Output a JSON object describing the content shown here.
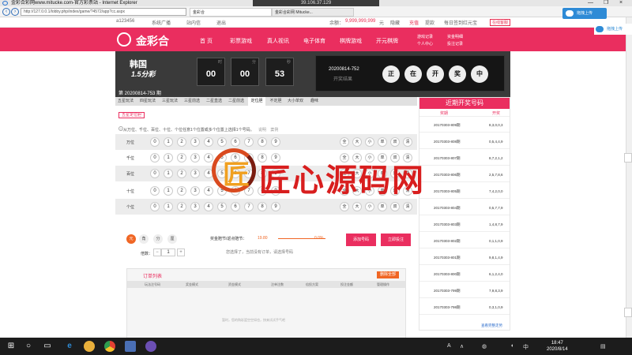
{
  "remote": {
    "ip": "39.106.37.129",
    "min": "—",
    "restore": "❐",
    "close": "×"
  },
  "ie": {
    "title": "金彩合彩网www.mitucke.com-官方彩票站 - Internet Explorer",
    "address": "http://127.0.0.1/lobby.php/index/game/?4572/app?cc.aspx",
    "tabs": [
      "金彩合",
      "金彩合彩网 Mitucke..."
    ],
    "nav_back": "‹",
    "nav_forward": "›"
  },
  "site_top": {
    "user": "a123456",
    "notice": "系统广播",
    "messages": "站内信",
    "logout_link": "退出",
    "balance_label": "余额：",
    "balance": "9,999,999,999",
    "balance_unit": "元",
    "hide": "隐藏",
    "recharge": "充值",
    "withdraw": "提款",
    "signin": "每日签到红元宝",
    "logout_btn": "在线客服"
  },
  "header": {
    "brand": "金彩合",
    "menu": [
      "首 页",
      "彩票游戏",
      "真人视讯",
      "电子体育",
      "棋牌游戏",
      "开元棋牌"
    ],
    "quick": [
      "游戏记录",
      "资金明细",
      "个人中心",
      "投注记录"
    ]
  },
  "banner": {
    "name": "韩国",
    "sub": "1.5分彩",
    "current_period": "第 20200814-753 期",
    "countdown": {
      "hours": "00",
      "minutes": "00",
      "seconds": "53",
      "unit_h": "时",
      "unit_m": "分",
      "unit_s": "秒"
    },
    "last_period": "20200814-752",
    "last_status": "开奖结果",
    "drawing_balls": [
      "正",
      "在",
      "开",
      "奖",
      "中"
    ]
  },
  "play_tabs": [
    "五星玩法",
    "四星玩法",
    "三星玩法",
    "三星前选",
    "二星直选",
    "二星前选",
    "定位胆",
    "不定胆",
    "大小单双",
    "趣味"
  ],
  "play_active_index": 6,
  "mode": {
    "name": "五星定位胆",
    "hint": "从万位、千位、百位、十位、个位任意1个位置或多个位置上选择1个号码。",
    "hint_link1": "说明",
    "hint_link2": "案例"
  },
  "rows": [
    {
      "label": "万位"
    },
    {
      "label": "千位"
    },
    {
      "label": "百位"
    },
    {
      "label": "十位"
    },
    {
      "label": "个位"
    }
  ],
  "digits": [
    "0",
    "1",
    "2",
    "3",
    "4",
    "5",
    "6",
    "7",
    "8",
    "9"
  ],
  "shortcuts": [
    "全",
    "大",
    "小",
    "单",
    "双",
    "清"
  ],
  "bet": {
    "units": [
      "元",
      "角",
      "分",
      "厘"
    ],
    "multiplier_label": "倍数：",
    "minus": "−",
    "plus": "+",
    "multiplier": "1",
    "odds_label": "奖金赔节/返点赔节：",
    "odds": "19.80",
    "rebate": "0.0%",
    "selected_tip": "您选择了，当前没有订单，请选择号码",
    "add_btn": "添加号码",
    "bet_btn": "立即投注"
  },
  "orders": {
    "title": "订单列表",
    "clear": "删除全部",
    "cols": [
      "玩法注号码",
      "奖金模式",
      "资金模式",
      "注单注数",
      "倍投方案",
      "投注金额",
      "管理操作"
    ],
    "empty": "暂时，您的购彩篮空空如也，快来试试手气吧"
  },
  "recent": {
    "title": "近期开奖号码",
    "col_period": "奖期",
    "col_result": "开奖",
    "more": "查看完整走势",
    "items": [
      {
        "period": "20170303-809期",
        "nums": "8,3,0,0,3"
      },
      {
        "period": "20170303-808期",
        "nums": "0,5,4,4,9"
      },
      {
        "period": "20170303-807期",
        "nums": "8,7,2,1,2"
      },
      {
        "period": "20170303-806期",
        "nums": "2,5,7,8,6"
      },
      {
        "period": "20170303-805期",
        "nums": "7,4,2,0,0"
      },
      {
        "period": "20170303-804期",
        "nums": "0,5,7,7,9"
      },
      {
        "period": "20170303-803期",
        "nums": "1,4,8,7,9"
      },
      {
        "period": "20170303-802期",
        "nums": "0,1,1,0,9"
      },
      {
        "period": "20170303-801期",
        "nums": "9,8,1,4,9"
      },
      {
        "period": "20170303-800期",
        "nums": "6,1,2,4,0"
      },
      {
        "period": "20170303-799期",
        "nums": "7,9,8,3,9"
      },
      {
        "period": "20170303-798期",
        "nums": "0,3,1,0,9"
      }
    ]
  },
  "watermark": {
    "letter": "匠",
    "text": "匠心源码网"
  },
  "float": {
    "upload": "拖拽上传",
    "upload2": "拖拽上传"
  },
  "taskbar": {
    "time": "18:47",
    "date": "2020/8/14",
    "ime": "中",
    "start": "⊞",
    "search": "○",
    "task_view": "▭",
    "edge": "e",
    "speaker": "◖",
    "network": "◍",
    "up_arrow": "∧",
    "ime_a": "A",
    "notify": "▤"
  },
  "colors": {
    "brand": "#ea2e5f",
    "accent": "#f06624",
    "banner_bg": "#3a3a3a"
  }
}
